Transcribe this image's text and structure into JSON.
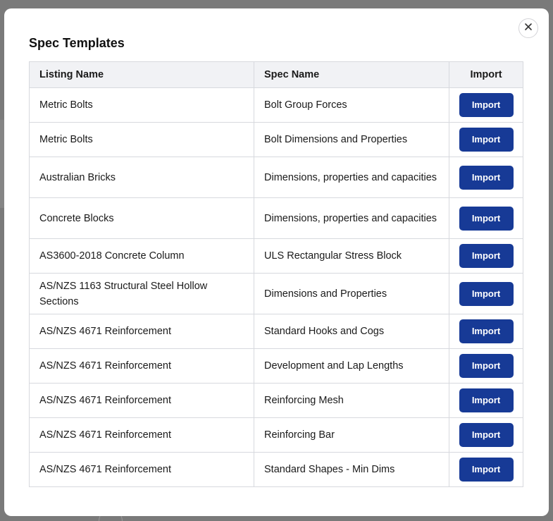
{
  "modal": {
    "title": "Spec Templates",
    "close_icon": "close-icon"
  },
  "table": {
    "headers": {
      "listing_name": "Listing Name",
      "spec_name": "Spec Name",
      "import": "Import"
    },
    "rows": [
      {
        "listing": "Metric Bolts",
        "spec": "Bolt Group Forces",
        "action": "Import"
      },
      {
        "listing": "Metric Bolts",
        "spec": "Bolt Dimensions and Properties",
        "action": "Import"
      },
      {
        "listing": "Australian Bricks",
        "spec": "Dimensions, properties and capacities",
        "action": "Import"
      },
      {
        "listing": "Concrete Blocks",
        "spec": "Dimensions, properties and capacities",
        "action": "Import"
      },
      {
        "listing": "AS3600-2018 Concrete Column",
        "spec": "ULS Rectangular Stress Block",
        "action": "Import"
      },
      {
        "listing": "AS/NZS 1163 Structural Steel Hollow Sections",
        "spec": "Dimensions and Properties",
        "action": "Import"
      },
      {
        "listing": "AS/NZS 4671 Reinforcement",
        "spec": "Standard Hooks and Cogs",
        "action": "Import"
      },
      {
        "listing": "AS/NZS 4671 Reinforcement",
        "spec": "Development and Lap Lengths",
        "action": "Import"
      },
      {
        "listing": "AS/NZS 4671 Reinforcement",
        "spec": "Reinforcing Mesh",
        "action": "Import"
      },
      {
        "listing": "AS/NZS 4671 Reinforcement",
        "spec": "Reinforcing Bar",
        "action": "Import"
      },
      {
        "listing": "AS/NZS 4671 Reinforcement",
        "spec": "Standard Shapes - Min Dims",
        "action": "Import"
      }
    ]
  },
  "colors": {
    "button": "#173a96",
    "header_bg": "#f1f2f5",
    "overlay": "#7a7a7a"
  }
}
